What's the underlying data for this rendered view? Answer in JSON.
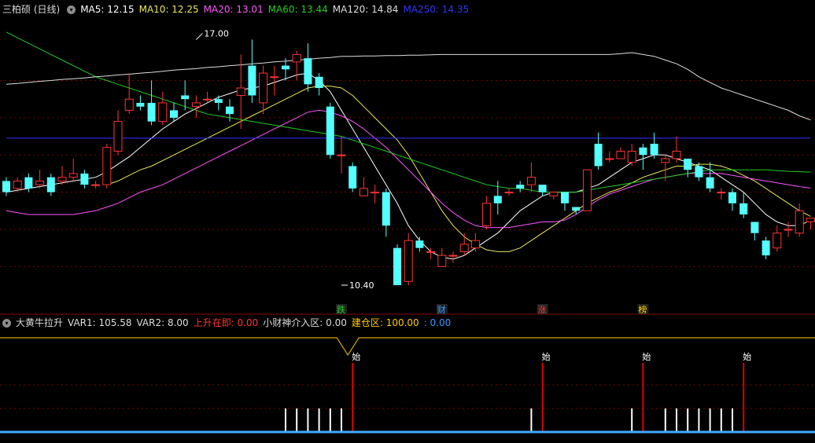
{
  "top_header": {
    "stock": "三柏硕 (日线)",
    "ma": [
      {
        "label": "MA5: 12.15",
        "color": "#ffffff"
      },
      {
        "label": "MA10: 12.25",
        "color": "#e8e85a"
      },
      {
        "label": "MA20: 13.01",
        "color": "#ff55ff"
      },
      {
        "label": "MA60: 13.44",
        "color": "#22cc22"
      },
      {
        "label": "MA120: 14.84",
        "color": "#dddddd"
      },
      {
        "label": "MA250: 14.35",
        "color": "#3333ff"
      }
    ]
  },
  "bottom_header": {
    "name": "大黄牛拉升",
    "items": [
      {
        "label": "VAR1: 105.58",
        "color": "#dddddd"
      },
      {
        "label": "VAR2: 8.00",
        "color": "#dddddd"
      },
      {
        "label": "上升在即: 0.00",
        "color": "#ff3333"
      },
      {
        "label": "小财神介入区: 0.00",
        "color": "#dddddd"
      },
      {
        "label": "建仓区: 100.00",
        "color": "#ffcc00"
      },
      {
        "label": ": 0.00",
        "color": "#3399ff"
      }
    ]
  },
  "colors": {
    "up": "#ff3333",
    "down": "#54ffff",
    "grid": "#7a0000",
    "ma5": "#ffffff",
    "ma10": "#e8e85a",
    "ma20": "#ff55ff",
    "ma60": "#22cc22",
    "ma120": "#dddddd",
    "ma250": "#3333ff",
    "signal_red": "#dd0000",
    "signal_white": "#ffffff",
    "baseline": "#44aaff",
    "warehouse_line": "#ffcc00"
  },
  "chart_data": {
    "type": "candlestick",
    "title": "三柏硕 (日线)",
    "ylim": [
      10.0,
      17.6
    ],
    "annotations": [
      {
        "text": "17.00",
        "index": 17,
        "price": 17.0
      },
      {
        "text": "10.40",
        "index": 30,
        "price": 10.4
      }
    ],
    "candles": [
      [
        13.2,
        12.9,
        13.3,
        12.8
      ],
      [
        13.0,
        13.2,
        13.3,
        12.9
      ],
      [
        13.3,
        13.0,
        13.4,
        12.9
      ],
      [
        13.1,
        13.2,
        13.5,
        13.0
      ],
      [
        13.3,
        12.9,
        13.4,
        12.8
      ],
      [
        13.2,
        13.3,
        13.6,
        13.1
      ],
      [
        13.3,
        13.4,
        13.8,
        13.2
      ],
      [
        13.4,
        13.1,
        13.5,
        13.0
      ],
      [
        13.1,
        13.1,
        13.2,
        13.0
      ],
      [
        13.1,
        14.1,
        14.2,
        13.0
      ],
      [
        14.0,
        14.8,
        15.1,
        13.9
      ],
      [
        15.1,
        15.4,
        16.1,
        15.0
      ],
      [
        15.3,
        15.2,
        15.5,
        15.1
      ],
      [
        15.3,
        14.8,
        15.9,
        14.7
      ],
      [
        14.8,
        15.3,
        15.6,
        14.7
      ],
      [
        15.1,
        14.9,
        15.3,
        14.8
      ],
      [
        15.5,
        15.4,
        15.9,
        15.1
      ],
      [
        15.2,
        15.3,
        15.5,
        14.9
      ],
      [
        15.4,
        15.4,
        15.6,
        15.3
      ],
      [
        15.4,
        15.3,
        15.5,
        15.1
      ],
      [
        15.2,
        15.0,
        15.4,
        14.8
      ],
      [
        15.5,
        15.7,
        16.6,
        14.6
      ],
      [
        16.3,
        15.5,
        17.0,
        15.3
      ],
      [
        15.3,
        16.1,
        16.3,
        15.0
      ],
      [
        16.0,
        16.0,
        16.3,
        15.5
      ],
      [
        16.3,
        16.2,
        16.5,
        15.9
      ],
      [
        16.4,
        16.6,
        16.7,
        15.9
      ],
      [
        16.5,
        15.8,
        16.9,
        15.6
      ],
      [
        16.0,
        15.7,
        16.1,
        15.5
      ],
      [
        15.2,
        13.9,
        15.3,
        13.8
      ],
      [
        13.9,
        13.9,
        14.4,
        13.4
      ],
      [
        13.6,
        13.0,
        13.7,
        12.9
      ],
      [
        12.8,
        13.0,
        13.3,
        12.8
      ],
      [
        12.9,
        12.9,
        13.1,
        12.6
      ],
      [
        12.9,
        12.0,
        13.0,
        11.7
      ],
      [
        11.4,
        10.4,
        11.5,
        10.4
      ],
      [
        10.5,
        11.6,
        11.8,
        10.4
      ],
      [
        11.6,
        11.4,
        11.7,
        11.3
      ],
      [
        11.3,
        11.3,
        11.4,
        11.1
      ],
      [
        10.9,
        11.2,
        11.4,
        10.9
      ],
      [
        11.2,
        11.2,
        11.3,
        11.0
      ],
      [
        11.3,
        11.5,
        11.8,
        11.2
      ],
      [
        11.4,
        11.6,
        11.8,
        11.3
      ],
      [
        12.0,
        12.6,
        12.8,
        11.9
      ],
      [
        12.8,
        12.6,
        13.2,
        12.3
      ],
      [
        12.9,
        12.9,
        13.0,
        12.8
      ],
      [
        13.1,
        13.0,
        13.2,
        12.9
      ],
      [
        13.1,
        13.3,
        13.7,
        12.9
      ],
      [
        13.1,
        12.9,
        13.1,
        12.8
      ],
      [
        12.8,
        12.9,
        12.9,
        12.7
      ],
      [
        12.9,
        12.6,
        12.9,
        12.4
      ],
      [
        12.5,
        12.4,
        12.5,
        12.3
      ],
      [
        12.4,
        13.5,
        13.5,
        12.4
      ],
      [
        14.2,
        13.6,
        14.5,
        13.5
      ],
      [
        13.8,
        13.8,
        14.0,
        13.7
      ],
      [
        13.8,
        14.0,
        14.1,
        13.8
      ],
      [
        13.7,
        14.0,
        14.2,
        13.6
      ],
      [
        14.1,
        13.9,
        14.2,
        13.5
      ],
      [
        14.2,
        13.9,
        14.5,
        13.8
      ],
      [
        13.7,
        13.8,
        13.9,
        13.2
      ],
      [
        13.8,
        14.0,
        14.4,
        13.7
      ],
      [
        13.8,
        13.5,
        13.8,
        13.3
      ],
      [
        13.6,
        13.3,
        13.7,
        13.2
      ],
      [
        13.3,
        13.0,
        13.7,
        12.9
      ],
      [
        12.9,
        12.9,
        13.0,
        12.7
      ],
      [
        12.9,
        12.6,
        13.0,
        12.4
      ],
      [
        12.6,
        12.3,
        12.9,
        12.2
      ],
      [
        12.1,
        11.8,
        12.1,
        11.6
      ],
      [
        11.6,
        11.2,
        11.7,
        11.1
      ],
      [
        11.4,
        11.8,
        12.0,
        11.3
      ],
      [
        11.9,
        11.9,
        12.1,
        11.7
      ],
      [
        11.8,
        12.4,
        12.6,
        11.7
      ],
      [
        12.1,
        12.2,
        12.2,
        11.9
      ]
    ],
    "series": [
      {
        "name": "MA5",
        "values": [
          12.9,
          12.95,
          13.0,
          13.05,
          13.1,
          13.15,
          13.2,
          13.25,
          13.3,
          13.45,
          13.65,
          13.85,
          14.1,
          14.35,
          14.6,
          14.8,
          15.0,
          15.15,
          15.3,
          15.45,
          15.55,
          15.65,
          15.7,
          15.75,
          15.85,
          15.95,
          16.05,
          16.1,
          15.9,
          15.6,
          15.1,
          14.6,
          14.1,
          13.6,
          13.1,
          12.6,
          12.0,
          11.6,
          11.3,
          11.15,
          11.1,
          11.2,
          11.4,
          11.6,
          11.8,
          12.1,
          12.4,
          12.6,
          12.8,
          12.9,
          12.9,
          12.9,
          13.0,
          13.1,
          13.3,
          13.5,
          13.7,
          13.8,
          13.9,
          13.9,
          13.8,
          13.7,
          13.6,
          13.5,
          13.3,
          13.1,
          12.9,
          12.6,
          12.3,
          12.1,
          12.0,
          12.0,
          12.15
        ]
      },
      {
        "name": "MA10",
        "values": [
          null,
          null,
          null,
          null,
          null,
          null,
          null,
          null,
          null,
          13.1,
          13.2,
          13.35,
          13.5,
          13.6,
          13.75,
          13.9,
          14.05,
          14.2,
          14.35,
          14.5,
          14.65,
          14.8,
          14.95,
          15.1,
          15.25,
          15.4,
          15.55,
          15.7,
          15.75,
          15.75,
          15.7,
          15.5,
          15.2,
          14.9,
          14.6,
          14.3,
          13.9,
          13.4,
          12.9,
          12.4,
          12.0,
          11.7,
          11.5,
          11.35,
          11.3,
          11.3,
          11.4,
          11.6,
          11.8,
          12.0,
          12.2,
          12.4,
          12.6,
          12.75,
          12.9,
          13.0,
          13.15,
          13.3,
          13.4,
          13.5,
          13.6,
          13.6,
          13.65,
          13.65,
          13.6,
          13.5,
          13.35,
          13.2,
          13.0,
          12.8,
          12.6,
          12.4,
          12.25
        ]
      },
      {
        "name": "MA20",
        "values": [
          12.4,
          12.35,
          12.3,
          12.3,
          12.3,
          12.3,
          12.3,
          12.35,
          12.4,
          12.5,
          12.6,
          12.75,
          12.9,
          13.0,
          13.1,
          13.25,
          13.4,
          13.55,
          13.7,
          13.85,
          14.0,
          14.15,
          14.3,
          14.45,
          14.6,
          14.75,
          14.9,
          15.05,
          15.1,
          15.05,
          14.95,
          14.8,
          14.6,
          14.35,
          14.1,
          13.8,
          13.5,
          13.2,
          12.9,
          12.6,
          12.35,
          12.15,
          12.0,
          11.95,
          11.95,
          11.95,
          12.0,
          12.05,
          12.1,
          12.1,
          12.15,
          12.3,
          12.5,
          12.7,
          12.85,
          12.95,
          13.05,
          13.15,
          13.25,
          13.3,
          13.35,
          13.4,
          13.4,
          13.4,
          13.4,
          13.35,
          13.3,
          13.25,
          13.2,
          13.15,
          13.1,
          13.05,
          13.01
        ]
      },
      {
        "name": "MA60",
        "values": [
          17.2,
          17.05,
          16.9,
          16.75,
          16.6,
          16.45,
          16.3,
          16.15,
          16.0,
          15.9,
          15.8,
          15.7,
          15.6,
          15.5,
          15.4,
          15.3,
          15.2,
          15.1,
          15.0,
          14.95,
          14.9,
          14.85,
          14.8,
          14.75,
          14.7,
          14.65,
          14.6,
          14.55,
          14.5,
          14.45,
          14.4,
          14.3,
          14.2,
          14.1,
          14.0,
          13.9,
          13.8,
          13.7,
          13.6,
          13.5,
          13.4,
          13.3,
          13.2,
          13.1,
          13.05,
          13.0,
          13.0,
          12.95,
          12.9,
          12.9,
          12.9,
          12.9,
          12.95,
          13.0,
          13.05,
          13.1,
          13.15,
          13.2,
          13.25,
          13.3,
          13.35,
          13.4,
          13.45,
          13.5,
          13.5,
          13.5,
          13.5,
          13.5,
          13.5,
          13.48,
          13.46,
          13.45,
          13.44
        ]
      },
      {
        "name": "MA120",
        "values": [
          15.8,
          15.82,
          15.85,
          15.88,
          15.9,
          15.93,
          15.95,
          15.97,
          16.0,
          16.02,
          16.05,
          16.07,
          16.1,
          16.12,
          16.15,
          16.18,
          16.2,
          16.22,
          16.25,
          16.27,
          16.3,
          16.32,
          16.35,
          16.37,
          16.4,
          16.42,
          16.45,
          16.47,
          16.5,
          16.52,
          16.55,
          16.55,
          16.56,
          16.56,
          16.57,
          16.57,
          16.58,
          16.58,
          16.59,
          16.6,
          16.6,
          16.6,
          16.6,
          16.6,
          16.6,
          16.6,
          16.6,
          16.6,
          16.6,
          16.6,
          16.6,
          16.6,
          16.6,
          16.6,
          16.6,
          16.62,
          16.65,
          16.6,
          16.55,
          16.45,
          16.35,
          16.2,
          16.0,
          15.85,
          15.7,
          15.6,
          15.5,
          15.4,
          15.3,
          15.2,
          15.1,
          14.95,
          14.84
        ]
      },
      {
        "name": "MA250",
        "values": [
          14.35,
          14.35,
          14.35,
          14.35,
          14.35,
          14.35,
          14.35,
          14.35,
          14.35,
          14.35,
          14.35,
          14.35,
          14.35,
          14.35,
          14.35,
          14.35,
          14.35,
          14.35,
          14.35,
          14.35,
          14.35,
          14.35,
          14.35,
          14.35,
          14.35,
          14.35,
          14.35,
          14.35,
          14.35,
          14.35,
          14.35,
          14.35,
          14.35,
          14.35,
          14.35,
          14.35,
          14.35,
          14.35,
          14.35,
          14.35,
          14.35,
          14.35,
          14.35,
          14.35,
          14.35,
          14.35,
          14.35,
          14.35,
          14.35,
          14.35,
          14.35,
          14.35,
          14.35,
          14.35,
          14.35,
          14.35,
          14.35,
          14.35,
          14.35,
          14.35,
          14.35,
          14.35,
          14.35,
          14.35,
          14.35,
          14.35,
          14.35,
          14.35,
          14.35,
          14.35,
          14.35,
          14.35,
          14.35
        ]
      }
    ],
    "markers": [
      {
        "text": "跌",
        "index": 30,
        "color": "#22cc22"
      },
      {
        "text": "财",
        "index": 39,
        "color": "#3399ff"
      },
      {
        "text": "涨",
        "index": 48,
        "color": "#ff3333"
      },
      {
        "text": "榜",
        "index": 57,
        "color": "#ffcc00"
      }
    ],
    "indicator": {
      "signal_label": "始",
      "red_signal_indices": [
        31,
        48,
        57,
        66
      ],
      "white_bar_indices": [
        25,
        26,
        27,
        28,
        29,
        30,
        47,
        56,
        59,
        60,
        61,
        62,
        63,
        64,
        65
      ]
    }
  }
}
